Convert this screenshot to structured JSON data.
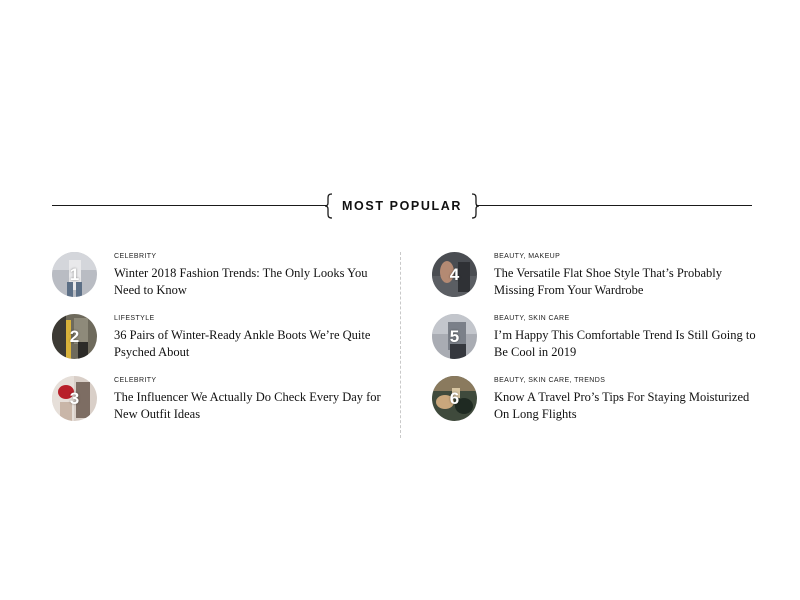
{
  "section": {
    "title": "MOST POPULAR"
  },
  "articles": [
    {
      "rank": "1",
      "category": "CELEBRITY",
      "title": "Winter 2018 Fashion Trends: The Only Looks You Need to Know"
    },
    {
      "rank": "2",
      "category": "LIFESTYLE",
      "title": "36 Pairs of Winter-Ready Ankle Boots We’re Quite Psyched About"
    },
    {
      "rank": "3",
      "category": "CELEBRITY",
      "title": "The Influencer We Actually Do Check Every Day for New Outfit Ideas"
    },
    {
      "rank": "4",
      "category": "BEAUTY, MAKEUP",
      "title": "The Versatile Flat Shoe Style That’s Probably Missing From Your Wardrobe"
    },
    {
      "rank": "5",
      "category": "BEAUTY, SKIN CARE",
      "title": "I’m Happy This Comfortable Trend Is Still Going to Be Cool in 2019"
    },
    {
      "rank": "6",
      "category": "BEAUTY, SKIN CARE, TRENDS",
      "title": "Know A Travel Pro’s Tips For Staying Moisturized On Long Flights"
    }
  ],
  "colors": {
    "text": "#111111",
    "rule": "#1a1a1a",
    "divider": "#c9c9c9",
    "badge_text": "#ffffff"
  }
}
